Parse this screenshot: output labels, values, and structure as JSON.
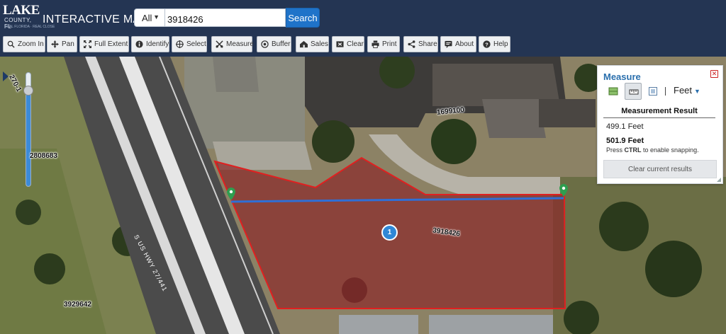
{
  "header": {
    "logo_title": "LAKE",
    "logo_subtitle": "COUNTY, FL",
    "logo_tagline": "REAL FLORIDA · REAL CLOSE",
    "app_title": "INTERACTIVE MAP"
  },
  "search": {
    "scope_selected": "All",
    "query": "3918426",
    "button_label": "Search"
  },
  "toolbar": [
    {
      "label": "Zoom In",
      "icon": "zoom-in-icon"
    },
    {
      "label": "Pan",
      "icon": "pan-icon"
    },
    {
      "label": "Full Extent",
      "icon": "full-extent-icon"
    },
    {
      "label": "Identify",
      "icon": "info-icon"
    },
    {
      "label": "Select",
      "icon": "select-icon"
    },
    {
      "label": "Measure",
      "icon": "measure-icon"
    },
    {
      "label": "Buffer",
      "icon": "buffer-icon"
    },
    {
      "label": "Sales",
      "icon": "sales-icon"
    },
    {
      "label": "Clear",
      "icon": "clear-icon"
    },
    {
      "label": "Print",
      "icon": "print-icon"
    },
    {
      "label": "Share",
      "icon": "share-icon"
    },
    {
      "label": "About",
      "icon": "about-icon"
    },
    {
      "label": "Help",
      "icon": "help-icon"
    }
  ],
  "map": {
    "parcel_labels": [
      "2808683",
      "3918426",
      "1699100",
      "3929642"
    ],
    "scale_label": "270-1",
    "road_label": "S US HWY 27/441",
    "feature_badge": "1",
    "colors": {
      "parcel_outline": "#e02020",
      "parcel_fill": "#8b2b2b",
      "measure_line": "#2f6fd6",
      "marker": "#2e9e4f"
    }
  },
  "measure_panel": {
    "title": "Measure",
    "unit": "Feet",
    "result_heading": "Measurement Result",
    "previous_value": "499.1 Feet",
    "current_value": "501.9 Feet",
    "snap_hint_prefix": "Press ",
    "snap_hint_key": "CTRL",
    "snap_hint_suffix": " to enable snapping.",
    "clear_button": "Clear current results"
  }
}
